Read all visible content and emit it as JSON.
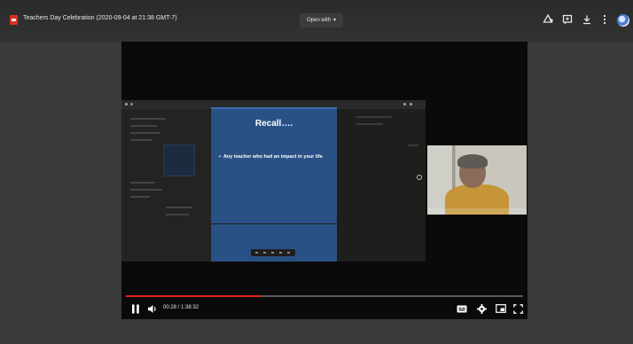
{
  "header": {
    "file_title": "Teachers Day Celebration (2020-09-04 at 21:38 GMT-7)",
    "open_with_label": "Open with",
    "icons": [
      "add-to-drive-icon",
      "comment-icon",
      "download-icon",
      "more-vert-icon",
      "account-avatar"
    ]
  },
  "slide": {
    "title": "Recall….",
    "bullet": "Any teacher who had an impact in your life"
  },
  "player": {
    "time_display": "00:28 / 1:38:32",
    "progress_fraction": 0.34,
    "icons": [
      "pause-icon",
      "volume-icon",
      "captions-icon",
      "settings-icon",
      "miniplayer-icon",
      "fullscreen-icon"
    ]
  },
  "colors": {
    "background": "#3a3a3a",
    "slide_blue": "#2a5185",
    "progress_red": "#e62117",
    "file_icon_red": "#d93025"
  }
}
